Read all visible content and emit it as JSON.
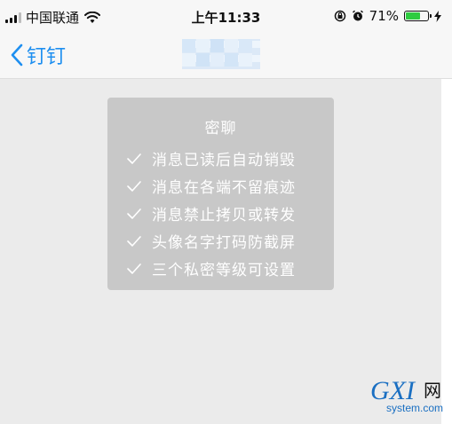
{
  "status_bar": {
    "carrier": "中国联通",
    "time": "上午11:33",
    "battery_percent": "71%",
    "battery_level": 0.71,
    "battery_color": "#2ecc40"
  },
  "nav": {
    "back_label": "钉钉",
    "accent_color": "#1e8ff0"
  },
  "secret_chat_card": {
    "title": "密聊",
    "features": [
      "消息已读后自动销毁",
      "消息在各端不留痕迹",
      "消息禁止拷贝或转发",
      "头像名字打码防截屏",
      "三个私密等级可设置"
    ]
  },
  "watermark": {
    "brand": "GXI",
    "brand_cn": "网",
    "domain": "system.com"
  }
}
